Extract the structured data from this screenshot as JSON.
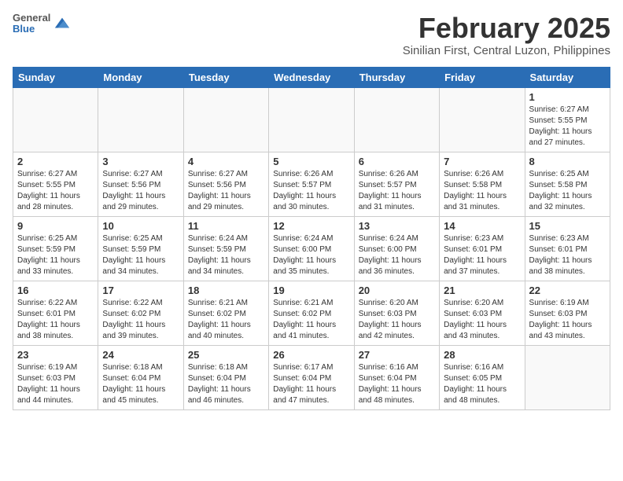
{
  "header": {
    "logo_line1": "General",
    "logo_line2": "Blue",
    "title": "February 2025",
    "subtitle": "Sinilian First, Central Luzon, Philippines"
  },
  "weekdays": [
    "Sunday",
    "Monday",
    "Tuesday",
    "Wednesday",
    "Thursday",
    "Friday",
    "Saturday"
  ],
  "weeks": [
    [
      {
        "day": "",
        "info": ""
      },
      {
        "day": "",
        "info": ""
      },
      {
        "day": "",
        "info": ""
      },
      {
        "day": "",
        "info": ""
      },
      {
        "day": "",
        "info": ""
      },
      {
        "day": "",
        "info": ""
      },
      {
        "day": "1",
        "info": "Sunrise: 6:27 AM\nSunset: 5:55 PM\nDaylight: 11 hours and 27 minutes."
      }
    ],
    [
      {
        "day": "2",
        "info": "Sunrise: 6:27 AM\nSunset: 5:55 PM\nDaylight: 11 hours and 28 minutes."
      },
      {
        "day": "3",
        "info": "Sunrise: 6:27 AM\nSunset: 5:56 PM\nDaylight: 11 hours and 29 minutes."
      },
      {
        "day": "4",
        "info": "Sunrise: 6:27 AM\nSunset: 5:56 PM\nDaylight: 11 hours and 29 minutes."
      },
      {
        "day": "5",
        "info": "Sunrise: 6:26 AM\nSunset: 5:57 PM\nDaylight: 11 hours and 30 minutes."
      },
      {
        "day": "6",
        "info": "Sunrise: 6:26 AM\nSunset: 5:57 PM\nDaylight: 11 hours and 31 minutes."
      },
      {
        "day": "7",
        "info": "Sunrise: 6:26 AM\nSunset: 5:58 PM\nDaylight: 11 hours and 31 minutes."
      },
      {
        "day": "8",
        "info": "Sunrise: 6:25 AM\nSunset: 5:58 PM\nDaylight: 11 hours and 32 minutes."
      }
    ],
    [
      {
        "day": "9",
        "info": "Sunrise: 6:25 AM\nSunset: 5:59 PM\nDaylight: 11 hours and 33 minutes."
      },
      {
        "day": "10",
        "info": "Sunrise: 6:25 AM\nSunset: 5:59 PM\nDaylight: 11 hours and 34 minutes."
      },
      {
        "day": "11",
        "info": "Sunrise: 6:24 AM\nSunset: 5:59 PM\nDaylight: 11 hours and 34 minutes."
      },
      {
        "day": "12",
        "info": "Sunrise: 6:24 AM\nSunset: 6:00 PM\nDaylight: 11 hours and 35 minutes."
      },
      {
        "day": "13",
        "info": "Sunrise: 6:24 AM\nSunset: 6:00 PM\nDaylight: 11 hours and 36 minutes."
      },
      {
        "day": "14",
        "info": "Sunrise: 6:23 AM\nSunset: 6:01 PM\nDaylight: 11 hours and 37 minutes."
      },
      {
        "day": "15",
        "info": "Sunrise: 6:23 AM\nSunset: 6:01 PM\nDaylight: 11 hours and 38 minutes."
      }
    ],
    [
      {
        "day": "16",
        "info": "Sunrise: 6:22 AM\nSunset: 6:01 PM\nDaylight: 11 hours and 38 minutes."
      },
      {
        "day": "17",
        "info": "Sunrise: 6:22 AM\nSunset: 6:02 PM\nDaylight: 11 hours and 39 minutes."
      },
      {
        "day": "18",
        "info": "Sunrise: 6:21 AM\nSunset: 6:02 PM\nDaylight: 11 hours and 40 minutes."
      },
      {
        "day": "19",
        "info": "Sunrise: 6:21 AM\nSunset: 6:02 PM\nDaylight: 11 hours and 41 minutes."
      },
      {
        "day": "20",
        "info": "Sunrise: 6:20 AM\nSunset: 6:03 PM\nDaylight: 11 hours and 42 minutes."
      },
      {
        "day": "21",
        "info": "Sunrise: 6:20 AM\nSunset: 6:03 PM\nDaylight: 11 hours and 43 minutes."
      },
      {
        "day": "22",
        "info": "Sunrise: 6:19 AM\nSunset: 6:03 PM\nDaylight: 11 hours and 43 minutes."
      }
    ],
    [
      {
        "day": "23",
        "info": "Sunrise: 6:19 AM\nSunset: 6:03 PM\nDaylight: 11 hours and 44 minutes."
      },
      {
        "day": "24",
        "info": "Sunrise: 6:18 AM\nSunset: 6:04 PM\nDaylight: 11 hours and 45 minutes."
      },
      {
        "day": "25",
        "info": "Sunrise: 6:18 AM\nSunset: 6:04 PM\nDaylight: 11 hours and 46 minutes."
      },
      {
        "day": "26",
        "info": "Sunrise: 6:17 AM\nSunset: 6:04 PM\nDaylight: 11 hours and 47 minutes."
      },
      {
        "day": "27",
        "info": "Sunrise: 6:16 AM\nSunset: 6:04 PM\nDaylight: 11 hours and 48 minutes."
      },
      {
        "day": "28",
        "info": "Sunrise: 6:16 AM\nSunset: 6:05 PM\nDaylight: 11 hours and 48 minutes."
      },
      {
        "day": "",
        "info": ""
      }
    ]
  ]
}
